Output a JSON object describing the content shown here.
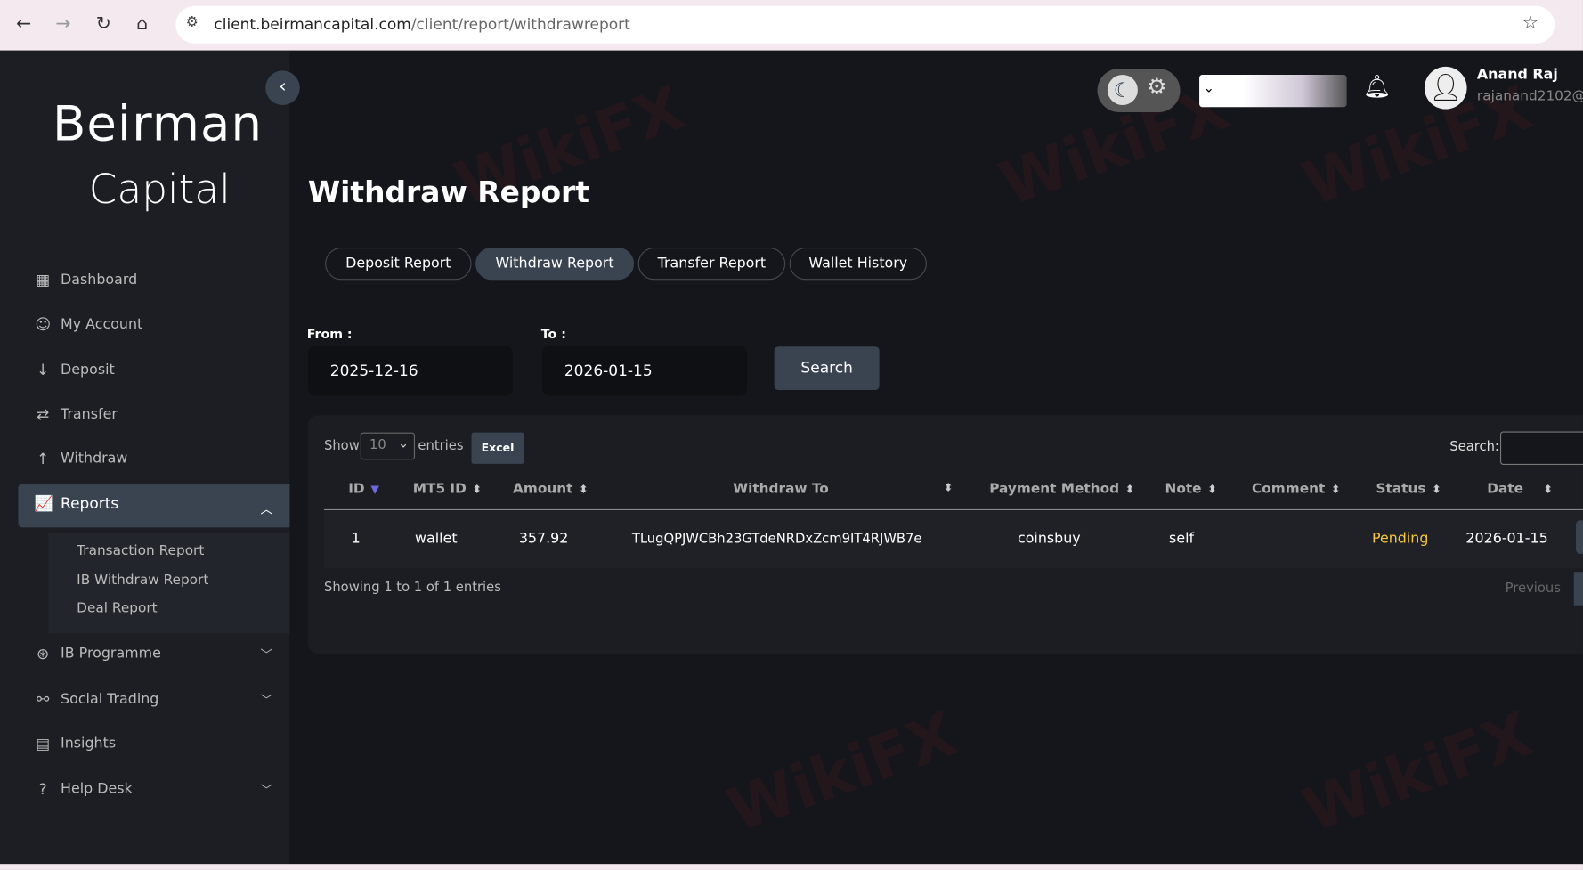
{
  "browser": {
    "url_domain": "client.beirmancapital.com",
    "url_path": "/client/report/withdrawreport"
  },
  "logo": {
    "line1": "Beirman",
    "line2": "Capital"
  },
  "header": {
    "user_name": "Anand Raj",
    "user_email": "rajanand2102@g"
  },
  "sidebar": {
    "items": [
      {
        "label": "Dashboard",
        "icon": "grid-icon"
      },
      {
        "label": "My Account",
        "icon": "user-icon"
      },
      {
        "label": "Deposit",
        "icon": "arrow-down-icon"
      },
      {
        "label": "Transfer",
        "icon": "transfer-icon"
      },
      {
        "label": "Withdraw",
        "icon": "arrow-up-icon"
      },
      {
        "label": "Reports",
        "icon": "chart-icon"
      },
      {
        "label": "IB Programme",
        "icon": "ball-icon"
      },
      {
        "label": "Social Trading",
        "icon": "network-icon"
      },
      {
        "label": "Insights",
        "icon": "news-icon"
      },
      {
        "label": "Help Desk",
        "icon": "help-icon"
      }
    ],
    "sub_items": [
      "Transaction Report",
      "IB Withdraw Report",
      "Deal Report"
    ]
  },
  "page": {
    "title": "Withdraw Report",
    "tabs": [
      "Deposit Report",
      "Withdraw Report",
      "Transfer Report",
      "Wallet History"
    ],
    "from_label": "From :",
    "from_value": "2025-12-16",
    "to_label": "To :",
    "to_value": "2026-01-15",
    "search_button": "Search"
  },
  "table": {
    "show": "Show",
    "length": "10",
    "entries": "entries",
    "excel": "Excel",
    "search_label": "Search:",
    "columns": [
      "ID",
      "MT5 ID",
      "Amount",
      "Withdraw To",
      "Payment Method",
      "Note",
      "Comment",
      "Status",
      "Date"
    ],
    "rows": [
      {
        "id": "1",
        "mt5": "wallet",
        "amount": "357.92",
        "to": "TLugQPJWCBh23GTdeNRDxZcm9IT4RJWB7e",
        "method": "coinsbuy",
        "note": "self",
        "comment": "",
        "status": "Pending",
        "date": "2026-01-15"
      }
    ],
    "info": "Showing 1 to 1 of 1 entries",
    "previous": "Previous"
  },
  "watermark": "WikiFX"
}
